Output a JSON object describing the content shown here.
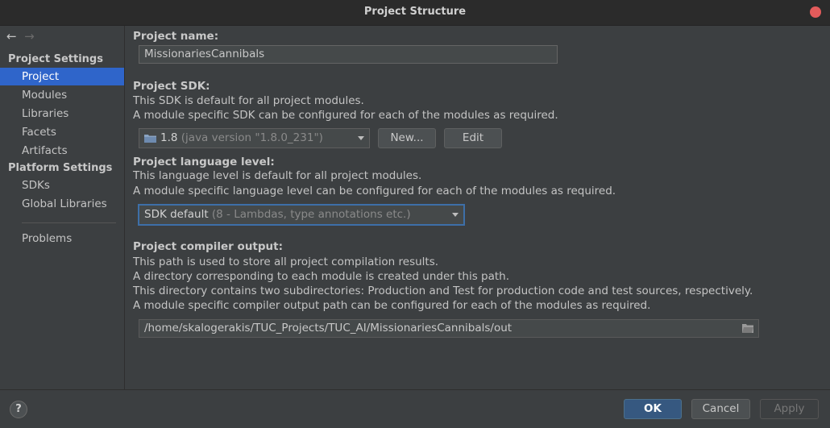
{
  "window": {
    "title": "Project Structure"
  },
  "sidebar": {
    "project_settings_header": "Project Settings",
    "project_items": [
      "Project",
      "Modules",
      "Libraries",
      "Facets",
      "Artifacts"
    ],
    "platform_settings_header": "Platform Settings",
    "platform_items": [
      "SDKs",
      "Global Libraries"
    ],
    "problems": "Problems",
    "selected": "Project"
  },
  "project_name": {
    "label": "Project name:",
    "value": "MissionariesCannibals"
  },
  "project_sdk": {
    "label": "Project SDK:",
    "desc1": "This SDK is default for all project modules.",
    "desc2": "A module specific SDK can be configured for each of the modules as required.",
    "selected_main": "1.8",
    "selected_detail": "(java version \"1.8.0_231\")",
    "new_button": "New...",
    "edit_button": "Edit"
  },
  "language_level": {
    "label": "Project language level:",
    "desc1": "This language level is default for all project modules.",
    "desc2": "A module specific language level can be configured for each of the modules as required.",
    "selected_main": "SDK default",
    "selected_detail": "(8 - Lambdas, type annotations etc.)"
  },
  "compiler_output": {
    "label": "Project compiler output:",
    "desc1": "This path is used to store all project compilation results.",
    "desc2": "A directory corresponding to each module is created under this path.",
    "desc3": "This directory contains two subdirectories: Production and Test for production code and test sources, respectively.",
    "desc4": "A module specific compiler output path can be configured for each of the modules as required.",
    "path": "/home/skalogerakis/TUC_Projects/TUC_AI/MissionariesCannibals/out"
  },
  "footer": {
    "help": "?",
    "ok": "OK",
    "cancel": "Cancel",
    "apply": "Apply"
  },
  "colors": {
    "selection": "#2f65ca",
    "ok_button": "#365880",
    "close_button": "#e35b5b",
    "focus_border": "#3d6fa8"
  },
  "icons": [
    "back-arrow-icon",
    "forward-arrow-icon",
    "close-icon",
    "folder-icon",
    "browse-folder-icon",
    "help-icon",
    "chevron-down-icon"
  ]
}
